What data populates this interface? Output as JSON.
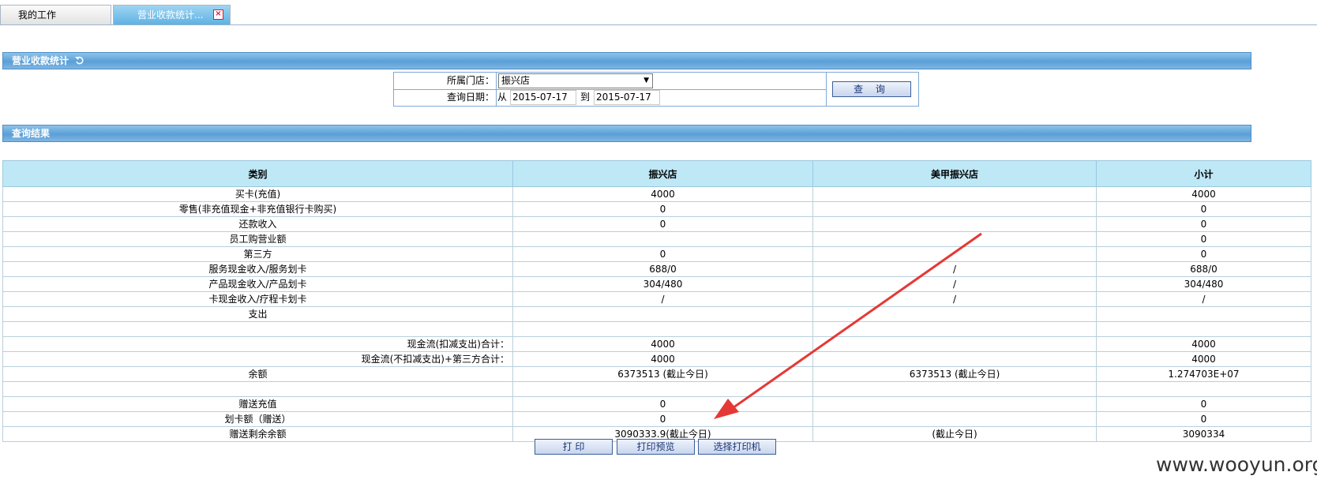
{
  "tabs": [
    {
      "label": "我的工作"
    },
    {
      "label": "营业收款统计..."
    }
  ],
  "stats_section": {
    "title": "营业收款统计"
  },
  "query": {
    "store_label": "所属门店：",
    "store_value": "振兴店",
    "date_label": "查询日期：",
    "from_label": "从",
    "from_value": "2015-07-17",
    "to_label": "到",
    "to_value": "2015-07-17",
    "button_label": "查 询"
  },
  "results_section": {
    "title": "查询结果"
  },
  "table": {
    "headers": [
      "类别",
      "振兴店",
      "美甲振兴店",
      "小计"
    ],
    "rows": [
      [
        "买卡(充值)",
        "4000",
        "",
        "4000"
      ],
      [
        "零售(非充值现金+非充值银行卡购买)",
        "0",
        "",
        "0"
      ],
      [
        "还款收入",
        "0",
        "",
        "0"
      ],
      [
        "员工购营业额",
        "",
        "",
        "0"
      ],
      [
        "第三方",
        "0",
        "",
        "0"
      ],
      [
        "服务现金收入/服务划卡",
        "688/0",
        "/",
        "688/0"
      ],
      [
        "产品现金收入/产品划卡",
        "304/480",
        "/",
        "304/480"
      ],
      [
        "卡现金收入/疗程卡划卡",
        "/",
        "/",
        "/"
      ],
      [
        "支出",
        "",
        "",
        ""
      ],
      [
        "",
        "",
        "",
        ""
      ],
      [
        "现金流(扣减支出)合计：",
        "4000",
        "",
        "4000"
      ],
      [
        "现金流(不扣减支出)+第三方合计：",
        "4000",
        "",
        "4000"
      ],
      [
        "余额",
        "6373513 (截止今日)",
        "6373513 (截止今日)",
        "1.274703E+07"
      ],
      [
        "",
        "",
        "",
        ""
      ],
      [
        "赠送充值",
        "0",
        "",
        "0"
      ],
      [
        "划卡额（赠送）",
        "0",
        "",
        "0"
      ],
      [
        "赠送剩余余额",
        "3090333.9(截止今日)",
        "(截止今日)",
        "3090334"
      ]
    ]
  },
  "actions": {
    "print": "打 印",
    "preview": "打印预览",
    "select_printer": "选择打印机"
  },
  "watermark": "www.wooyun.org",
  "colors": {
    "header_bar": "#5a9fd6",
    "table_header": "#bfe8f6",
    "annotation_arrow": "#e53935"
  }
}
